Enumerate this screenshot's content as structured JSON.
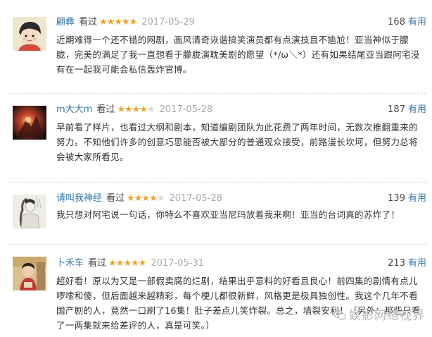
{
  "reviews": [
    {
      "user": "翩彝",
      "watched_label": "看过",
      "rating": 5,
      "date": "2017-05-29",
      "useful_count": "168",
      "useful_label": "有用",
      "text": "近期难得一个还不错的网剧，画风清奇诙谐搞笑演员都有点演技且不尴尬！亚当神似于朦胧，完美的满足了我一直想看于朦胧演耽美剧的愿望（*/ω＼*）还有如果结尾亚当跟阿宅没有在一起我可能会私信轰炸官博。",
      "avatar_icon": "cartoon-girl-avatar"
    },
    {
      "user": "m大大m",
      "watched_label": "看过",
      "rating": 4,
      "date": "2017-05-28",
      "useful_count": "187",
      "useful_label": "有用",
      "text": "早前看了样片，也看过大纲和剧本，知道编剧团队为此花费了两年时间，无数次推翻重来的努力。不知他们许多的创意巧思能否被大部分的普通观众接受，前路漫长坎坷，但努力总将会被大家所看见。",
      "avatar_icon": "dark-red-photo-avatar"
    },
    {
      "user": "请叫我神经",
      "watched_label": "看过",
      "rating": 4,
      "date": "2017-05-28",
      "useful_count": "139",
      "useful_label": "有用",
      "text": "我只想对阿宅说一句话，你特么不喜欢亚当尼玛放着我来啊！亚当的台词真的苏炸了！",
      "avatar_icon": "ink-painting-avatar"
    },
    {
      "user": "卜禾车",
      "watched_label": "看过",
      "rating": 5,
      "date": "2017-05-31",
      "useful_count": "213",
      "useful_label": "有用",
      "text": "超好看！原以为又是一部假卖腐的烂剧，结果出乎意料的好看且良心！前四集的剧情有点儿啰嗦和傻，但后面越来越精彩，每个梗儿都很新鲜，风格更是极具独创性。我这个几年不看国产剧的人，竟然一口刷了16集！肚子差点儿笑炸裂。总之，墙裂安利！（另外：那些只看了一两集就来给差评的人，真是可笑。）",
      "avatar_icon": "child-photo-avatar"
    }
  ],
  "watermark": "娱影网络视界",
  "colors": {
    "link": "#3377aa",
    "star_on": "#f2a127",
    "star_off": "#d9d9d9",
    "date": "#aaaaaa",
    "text": "#333333"
  }
}
